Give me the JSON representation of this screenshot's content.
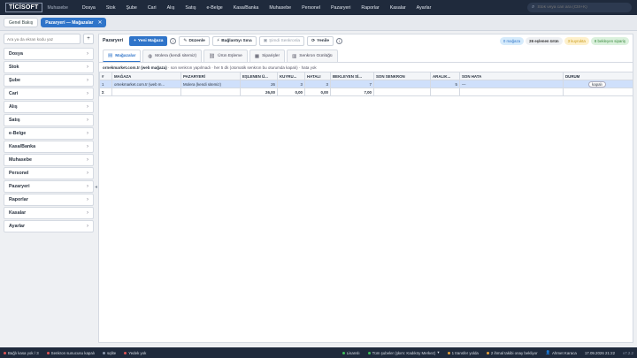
{
  "app": {
    "logo": "TİCİSOFT",
    "subtitle": "Muhasebe"
  },
  "menu": [
    "Dosya",
    "Stok",
    "Şube",
    "Cari",
    "Alış",
    "Satış",
    "e-Belge",
    "Kasa/Banka",
    "Muhasebe",
    "Personel",
    "Pazaryeri",
    "Raporlar",
    "Kasalar",
    "Ayarlar"
  ],
  "search": {
    "placeholder": "Stok veya cari ara (Ctrl+K)"
  },
  "tabs": {
    "home": "Genel Bakış",
    "active": "Pazaryeri — Mağazalar",
    "close": "✕"
  },
  "sidebar": {
    "search_placeholder": "Ara ya da ekran kodu yaz",
    "add": "+",
    "items": [
      "Dosya",
      "Stok",
      "Şube",
      "Cari",
      "Alış",
      "Satış",
      "e-Belge",
      "Kasa/Banka",
      "Muhasebe",
      "Personel",
      "Pazaryeri",
      "Raporlar",
      "Kasalar",
      "Ayarlar"
    ]
  },
  "toolbar": {
    "title": "Pazaryeri",
    "new_store": "Yeni Mağaza",
    "edit": "Düzenle",
    "test_connection": "Bağlantıyı Sına",
    "sync_now": "Şimdi Senkronla",
    "refresh": "Yenile",
    "pill_stores": "0 mağaza",
    "pill_matched": "26 eşlenen ürün",
    "pill_queue": "3 kuyrukta",
    "pill_pending": "8 bekleyen sipariş"
  },
  "subtabs": [
    "Mağazalar",
    "Molera (kendi sitemiz)",
    "Ürün Eşleme",
    "Siparişler",
    "Senkron Günlüğü"
  ],
  "status": {
    "store": "ornekmarket.com.tr (web mağaza)",
    "text": " · son senkron yapılmadı · her 5 dk (otomatik senkron bu oturumda kapalı) · hata yok"
  },
  "table": {
    "headers": [
      "#",
      "MAĞAZA",
      "PAZARYERİ",
      "EŞLENEN Ü...",
      "KUYRU...",
      "HATALI",
      "BEKLEYEN Sİ...",
      "SON SENKRON",
      "ARALIK...",
      "SON HATA",
      "DURUM"
    ],
    "row": {
      "no": "1",
      "store": "ornekmarket.com.tr (web m...",
      "market": "Molera (kendi sitemiz)",
      "matched": "26",
      "queue": "3",
      "error": "3",
      "pending": "7",
      "last_sync": "",
      "interval": "5",
      "last_error": "—",
      "state": "kapalı"
    },
    "total": {
      "label": "Σ",
      "matched": "26,00",
      "queue": "0,00",
      "error": "0,00",
      "pending": "7,00"
    }
  },
  "bottom": {
    "offline": "Bağlı kasa yok / 3",
    "server": "Senkron sunucusu kapalı",
    "sqlite": "sqlite",
    "backup": "Yedek yok",
    "license": "Lisanslı",
    "branch": "Tüm şubeler (şkım: Kadıköy Merkez)",
    "transfer": "1 transfer yolda",
    "invoice": "2 ihmal takibi onay bekliyor",
    "user": "Ahmet Karaca",
    "datetime": "17.09.2026 21:22",
    "version": "v7.2.2"
  },
  "colors": {
    "topbar": "#1f2a3c",
    "accent": "#2f74c9",
    "selected_row": "#cfe0fb"
  }
}
